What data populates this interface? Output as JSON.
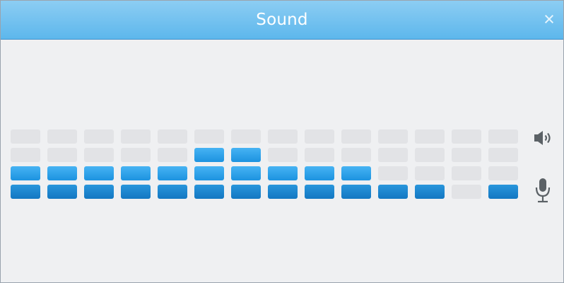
{
  "window": {
    "title": "Sound",
    "close_glyph": "×"
  },
  "icons": {
    "speaker": "speaker-icon",
    "microphone": "microphone-icon"
  },
  "colors": {
    "title_bar": "#5db7ec",
    "active_light": "#1d93e0",
    "active_dark": "#1377c2",
    "inactive": "#e2e3e6"
  },
  "meter": {
    "rows": 4,
    "columns": [
      {
        "output_level": 1,
        "input_level": 1
      },
      {
        "output_level": 1,
        "input_level": 1
      },
      {
        "output_level": 1,
        "input_level": 1
      },
      {
        "output_level": 1,
        "input_level": 1
      },
      {
        "output_level": 1,
        "input_level": 1
      },
      {
        "output_level": 2,
        "input_level": 1
      },
      {
        "output_level": 2,
        "input_level": 1
      },
      {
        "output_level": 1,
        "input_level": 1
      },
      {
        "output_level": 1,
        "input_level": 1
      },
      {
        "output_level": 1,
        "input_level": 1
      },
      {
        "output_level": 0,
        "input_level": 1
      },
      {
        "output_level": 0,
        "input_level": 1
      },
      {
        "output_level": 0,
        "input_level": 0
      },
      {
        "output_level": 0,
        "input_level": 1
      }
    ]
  }
}
